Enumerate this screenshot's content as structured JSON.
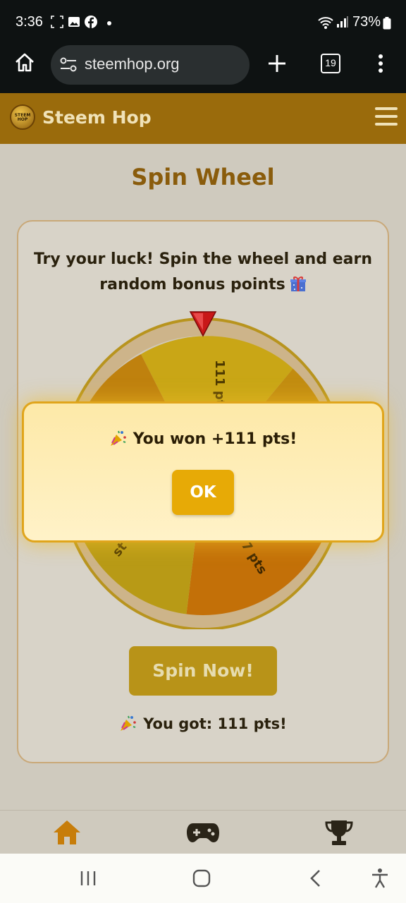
{
  "status_bar": {
    "time": "3:36",
    "battery": "73%"
  },
  "browser": {
    "url": "steemhop.org",
    "tab_count": "19"
  },
  "site": {
    "name": "Steem Hop",
    "logo_text": "STEEM HOP"
  },
  "page": {
    "title": "Spin Wheel",
    "intro": "Try your luck! Spin the wheel and earn random bonus points",
    "wheel_visible_labels": [
      "111 pts",
      "7 pts",
      "st"
    ],
    "spin_button": "Spin Now!",
    "result_text": "You got: 111 pts!"
  },
  "modal": {
    "message": "You won +111 pts!",
    "ok_label": "OK"
  },
  "bottom_nav": [
    "home-icon",
    "gamepad-icon",
    "trophy-icon"
  ],
  "colors": {
    "brand": "#9a6b0c",
    "accent": "#e7aa06",
    "title": "#8a5c0c"
  }
}
